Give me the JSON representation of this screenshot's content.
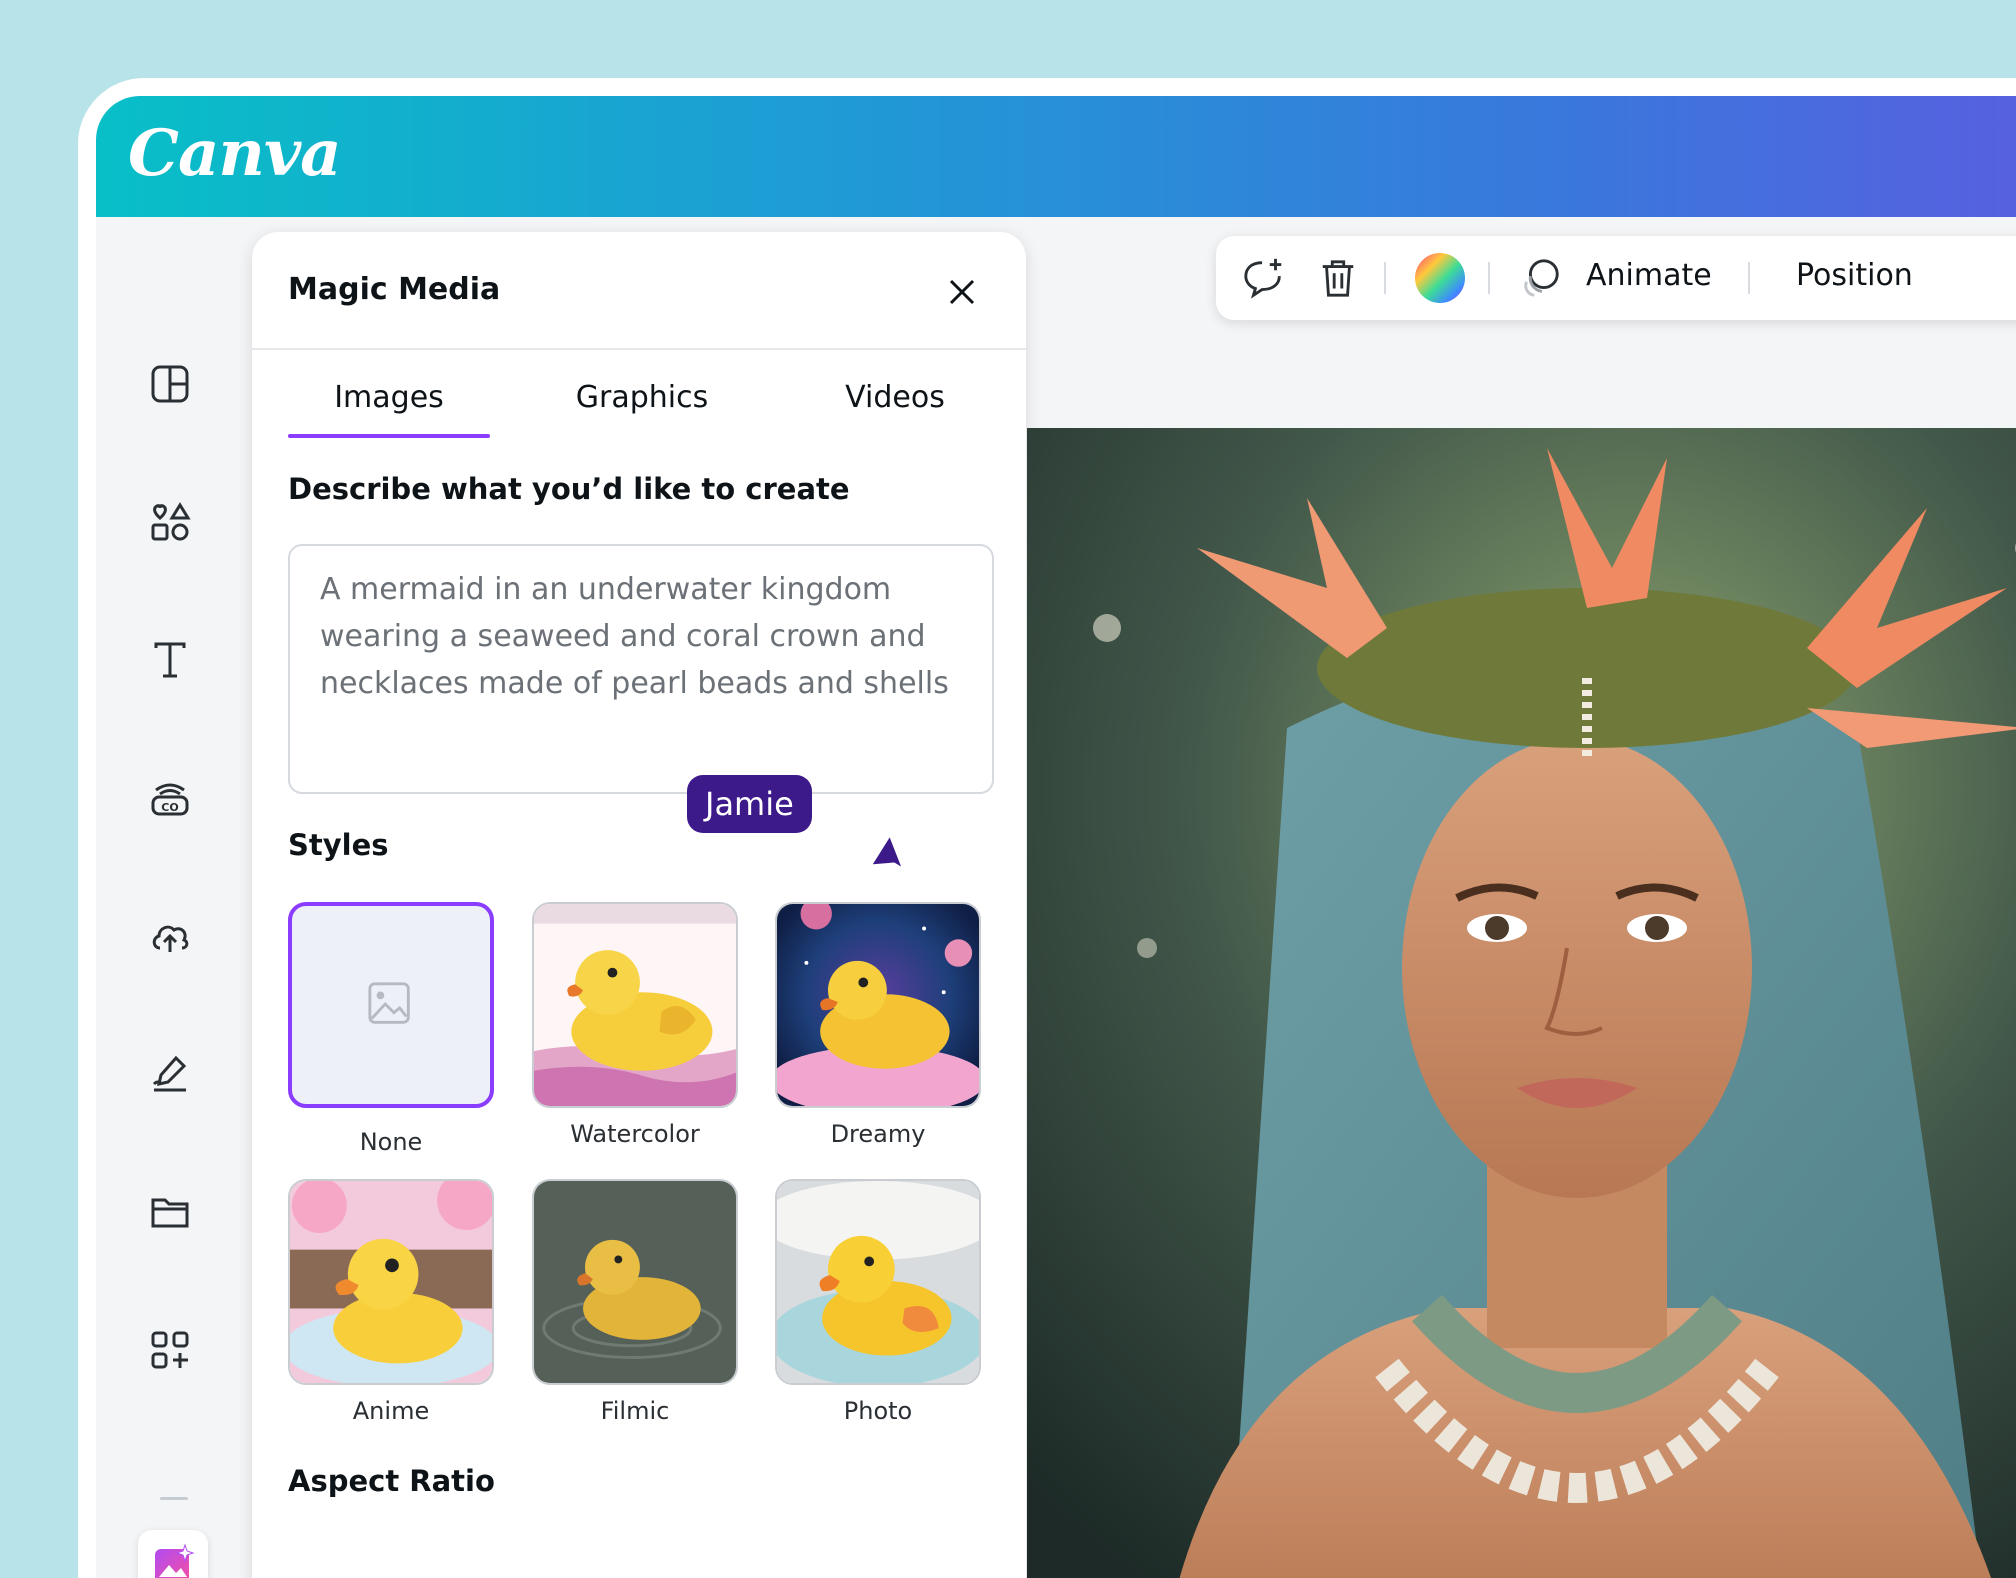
{
  "app": {
    "name": "Canva"
  },
  "panel": {
    "title": "Magic Media",
    "tabs": [
      {
        "label": "Images",
        "active": true
      },
      {
        "label": "Graphics",
        "active": false
      },
      {
        "label": "Videos",
        "active": false
      }
    ],
    "describe_label": "Describe what you’d like to create",
    "prompt_value": "A mermaid in an underwater kingdom\nwearing a seaweed and coral crown and\nnecklaces made of pearl beads and shells",
    "styles_label": "Styles",
    "styles": [
      {
        "label": "None",
        "selected": true
      },
      {
        "label": "Watercolor",
        "selected": false
      },
      {
        "label": "Dreamy",
        "selected": false
      },
      {
        "label": "Anime",
        "selected": false
      },
      {
        "label": "Filmic",
        "selected": false
      },
      {
        "label": "Photo",
        "selected": false
      }
    ],
    "aspect_label": "Aspect Ratio"
  },
  "collaborator": {
    "name": "Jamie",
    "color": "#3d1a8a"
  },
  "toolbar": {
    "animate_label": "Animate",
    "position_label": "Position"
  },
  "rail": {
    "icons": [
      "design-icon",
      "elements-icon",
      "text-icon",
      "brand-icon",
      "uploads-icon",
      "draw-icon",
      "projects-icon",
      "apps-icon",
      "magic-media-icon"
    ]
  },
  "colors": {
    "accent": "#8b3dff",
    "header_start": "#08bfc7",
    "header_end": "#5a5ee0"
  }
}
